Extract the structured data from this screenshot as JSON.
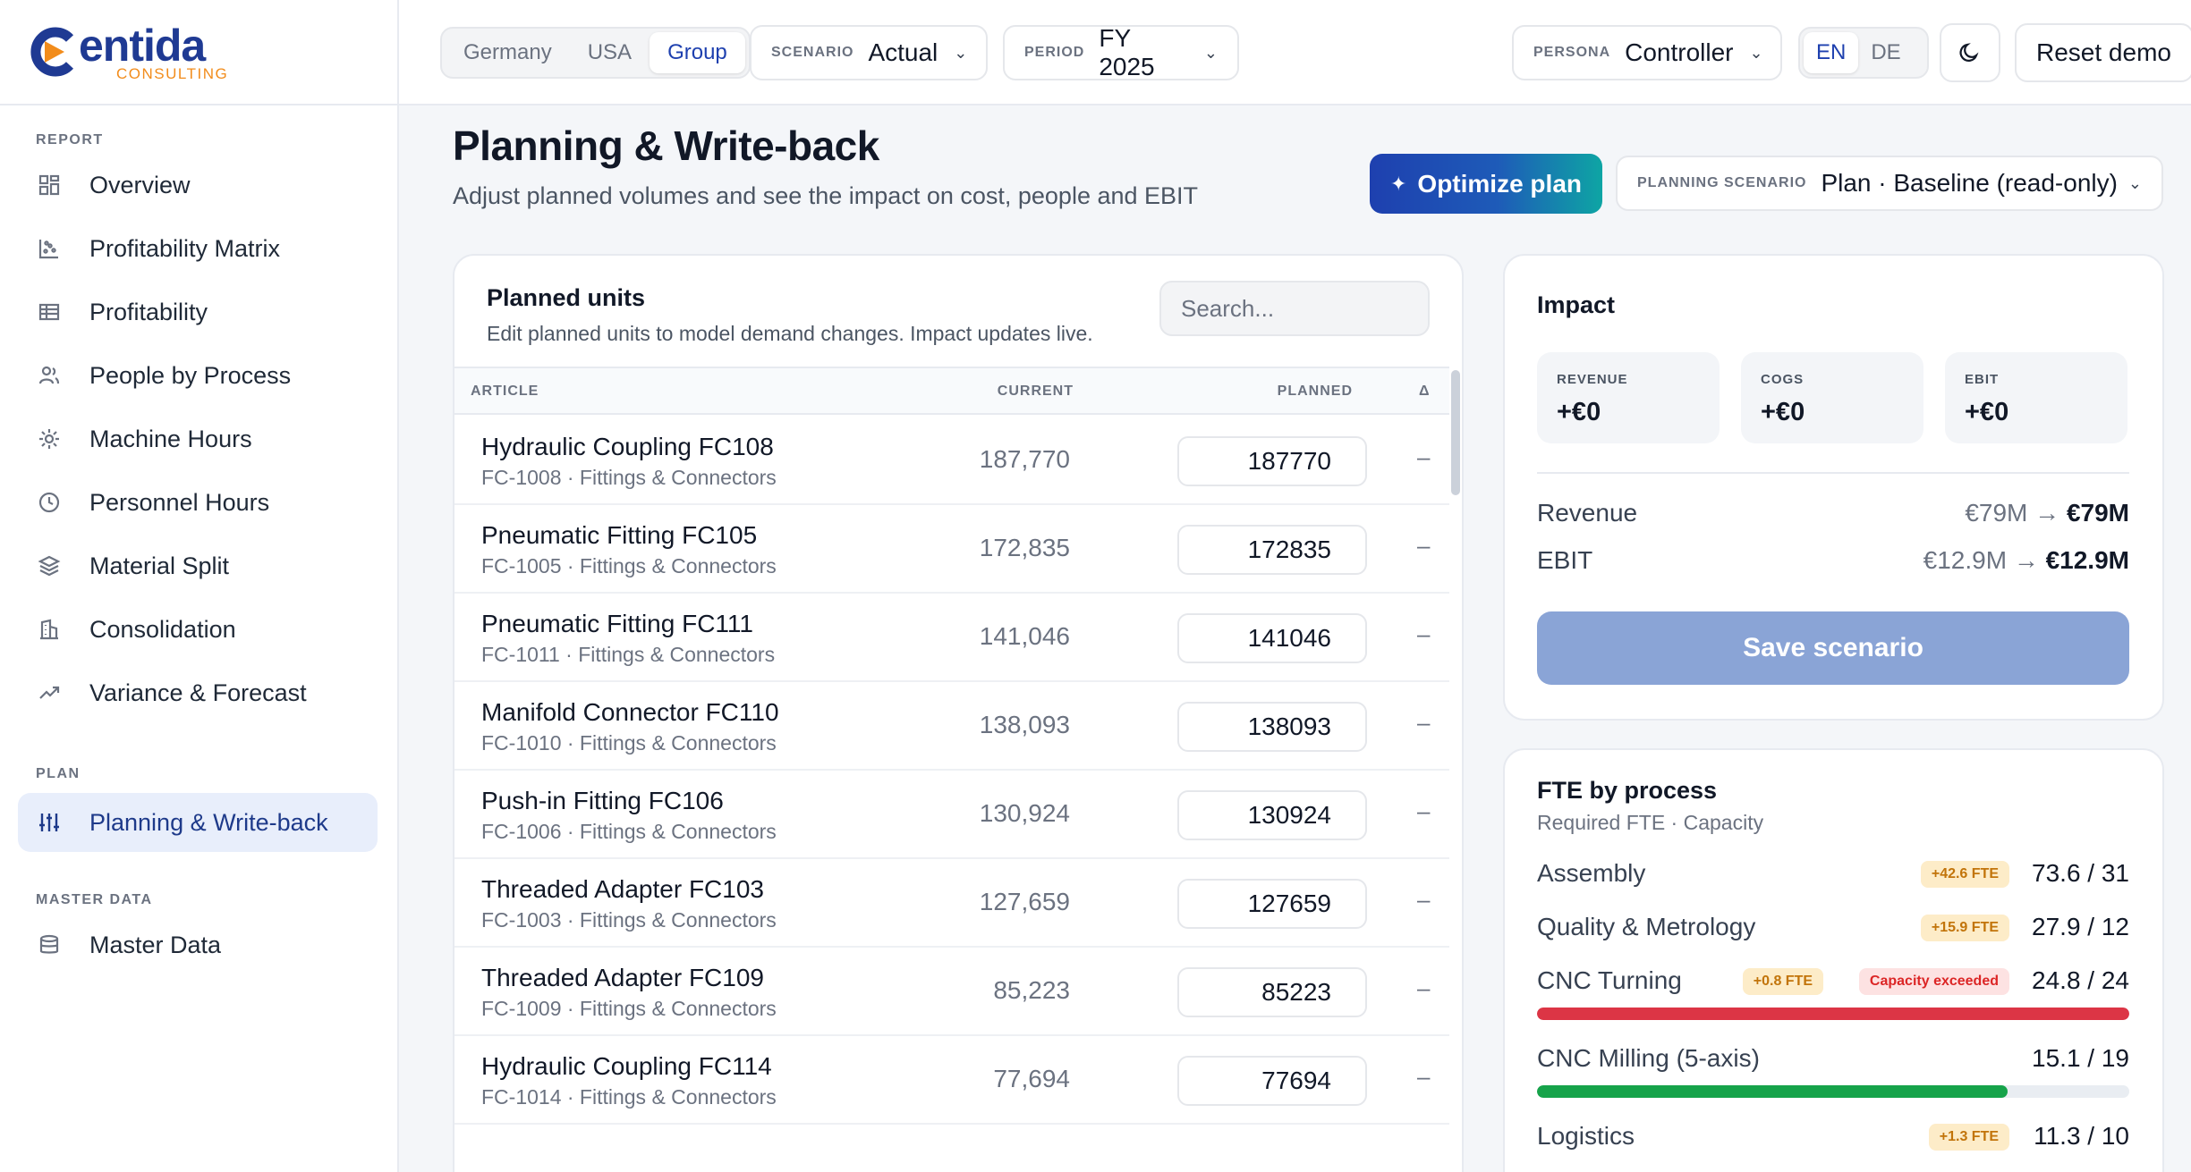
{
  "brand": {
    "word": "entida",
    "sub": "CONSULTING",
    "colors": {
      "primary": "#1f3a93",
      "accent": "#f28c1b"
    }
  },
  "sidebar": {
    "sections": [
      {
        "label": "REPORT",
        "items": [
          {
            "label": "Overview",
            "icon": "grid-icon"
          },
          {
            "label": "Profitability Matrix",
            "icon": "scatter-icon"
          },
          {
            "label": "Profitability",
            "icon": "table-icon"
          },
          {
            "label": "People by Process",
            "icon": "users-icon"
          },
          {
            "label": "Machine Hours",
            "icon": "gear-icon"
          },
          {
            "label": "Personnel Hours",
            "icon": "clock-icon"
          },
          {
            "label": "Material Split",
            "icon": "layers-icon"
          },
          {
            "label": "Consolidation",
            "icon": "building-icon"
          },
          {
            "label": "Variance & Forecast",
            "icon": "trend-icon"
          }
        ]
      },
      {
        "label": "PLAN",
        "items": [
          {
            "label": "Planning & Write-back",
            "icon": "sliders-icon",
            "active": true
          }
        ]
      },
      {
        "label": "MASTER DATA",
        "items": [
          {
            "label": "Master Data",
            "icon": "database-icon"
          }
        ]
      }
    ]
  },
  "topbar": {
    "entities": [
      "Germany",
      "USA",
      "Group"
    ],
    "entity_selected": "Group",
    "scenario": {
      "label": "SCENARIO",
      "value": "Actual"
    },
    "period": {
      "label": "PERIOD",
      "value": "FY 2025"
    },
    "persona": {
      "label": "PERSONA",
      "value": "Controller"
    },
    "languages": [
      "EN",
      "DE"
    ],
    "language_selected": "EN",
    "theme_icon": "moon-icon",
    "reset_label": "Reset demo"
  },
  "page": {
    "title": "Planning & Write-back",
    "subtitle": "Adjust planned volumes and see the impact on cost, people and EBIT",
    "optimize_label": "Optimize plan",
    "planning_scenario": {
      "label": "PLANNING SCENARIO",
      "value": "Plan · Baseline (read-only)"
    }
  },
  "units": {
    "title": "Planned units",
    "subtitle": "Edit planned units to model demand changes. Impact updates live.",
    "search_placeholder": "Search...",
    "columns": {
      "article": "ARTICLE",
      "current": "CURRENT",
      "planned": "PLANNED",
      "delta": "Δ"
    },
    "rows": [
      {
        "name": "Hydraulic Coupling FC108",
        "meta": "FC-1008 · Fittings & Connectors",
        "current": "187,770",
        "planned": "187770",
        "delta": "–"
      },
      {
        "name": "Pneumatic Fitting FC105",
        "meta": "FC-1005 · Fittings & Connectors",
        "current": "172,835",
        "planned": "172835",
        "delta": "–"
      },
      {
        "name": "Pneumatic Fitting FC111",
        "meta": "FC-1011 · Fittings & Connectors",
        "current": "141,046",
        "planned": "141046",
        "delta": "–"
      },
      {
        "name": "Manifold Connector FC110",
        "meta": "FC-1010 · Fittings & Connectors",
        "current": "138,093",
        "planned": "138093",
        "delta": "–"
      },
      {
        "name": "Push-in Fitting FC106",
        "meta": "FC-1006 · Fittings & Connectors",
        "current": "130,924",
        "planned": "130924",
        "delta": "–"
      },
      {
        "name": "Threaded Adapter FC103",
        "meta": "FC-1003 · Fittings & Connectors",
        "current": "127,659",
        "planned": "127659",
        "delta": "–"
      },
      {
        "name": "Threaded Adapter FC109",
        "meta": "FC-1009 · Fittings & Connectors",
        "current": "85,223",
        "planned": "85223",
        "delta": "–"
      },
      {
        "name": "Hydraulic Coupling FC114",
        "meta": "FC-1014 · Fittings & Connectors",
        "current": "77,694",
        "planned": "77694",
        "delta": "–"
      }
    ]
  },
  "impact": {
    "title": "Impact",
    "kpis": [
      {
        "label": "REVENUE",
        "value": "+€0"
      },
      {
        "label": "COGS",
        "value": "+€0"
      },
      {
        "label": "EBIT",
        "value": "+€0"
      }
    ],
    "rows": [
      {
        "label": "Revenue",
        "from": "€79M",
        "arrow": "→",
        "to": "€79M"
      },
      {
        "label": "EBIT",
        "from": "€12.9M",
        "arrow": "→",
        "to": "€12.9M"
      }
    ],
    "save_label": "Save scenario"
  },
  "fte": {
    "title": "FTE by process",
    "subtitle": "Required FTE · Capacity",
    "rows": [
      {
        "name": "Assembly",
        "badge": "+42.6 FTE",
        "value": "73.6 / 31"
      },
      {
        "name": "Quality & Metrology",
        "badge": "+15.9 FTE",
        "value": "27.9 / 12"
      },
      {
        "name": "CNC Turning",
        "badge": "+0.8 FTE",
        "alert": "Capacity exceeded",
        "value": "24.8 / 24",
        "utilization": 1.0,
        "bar_color": "#dc3545"
      },
      {
        "name": "CNC Milling (5-axis)",
        "value": "15.1 / 19",
        "utilization": 0.795,
        "bar_color": "#16a34a"
      },
      {
        "name": "Logistics",
        "badge": "+1.3 FTE",
        "value": "11.3 / 10"
      }
    ]
  }
}
